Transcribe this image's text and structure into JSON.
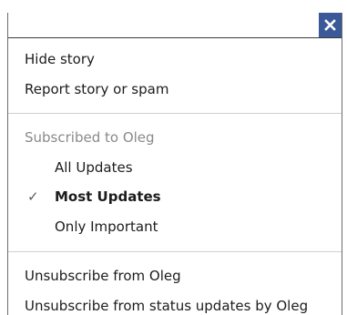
{
  "close_button": {
    "icon": "close-icon",
    "color": "#3b5998"
  },
  "story_actions": {
    "hide_story": "Hide story",
    "report_story": "Report story or spam"
  },
  "subscription": {
    "header": "Subscribed to Oleg",
    "options": [
      {
        "label": "All Updates",
        "selected": false
      },
      {
        "label": "Most Updates",
        "selected": true
      },
      {
        "label": "Only Important",
        "selected": false
      }
    ],
    "check_glyph": "✓"
  },
  "unsubscribe": {
    "from_user": "Unsubscribe from Oleg",
    "from_status": "Unsubscribe from status updates by Oleg"
  }
}
